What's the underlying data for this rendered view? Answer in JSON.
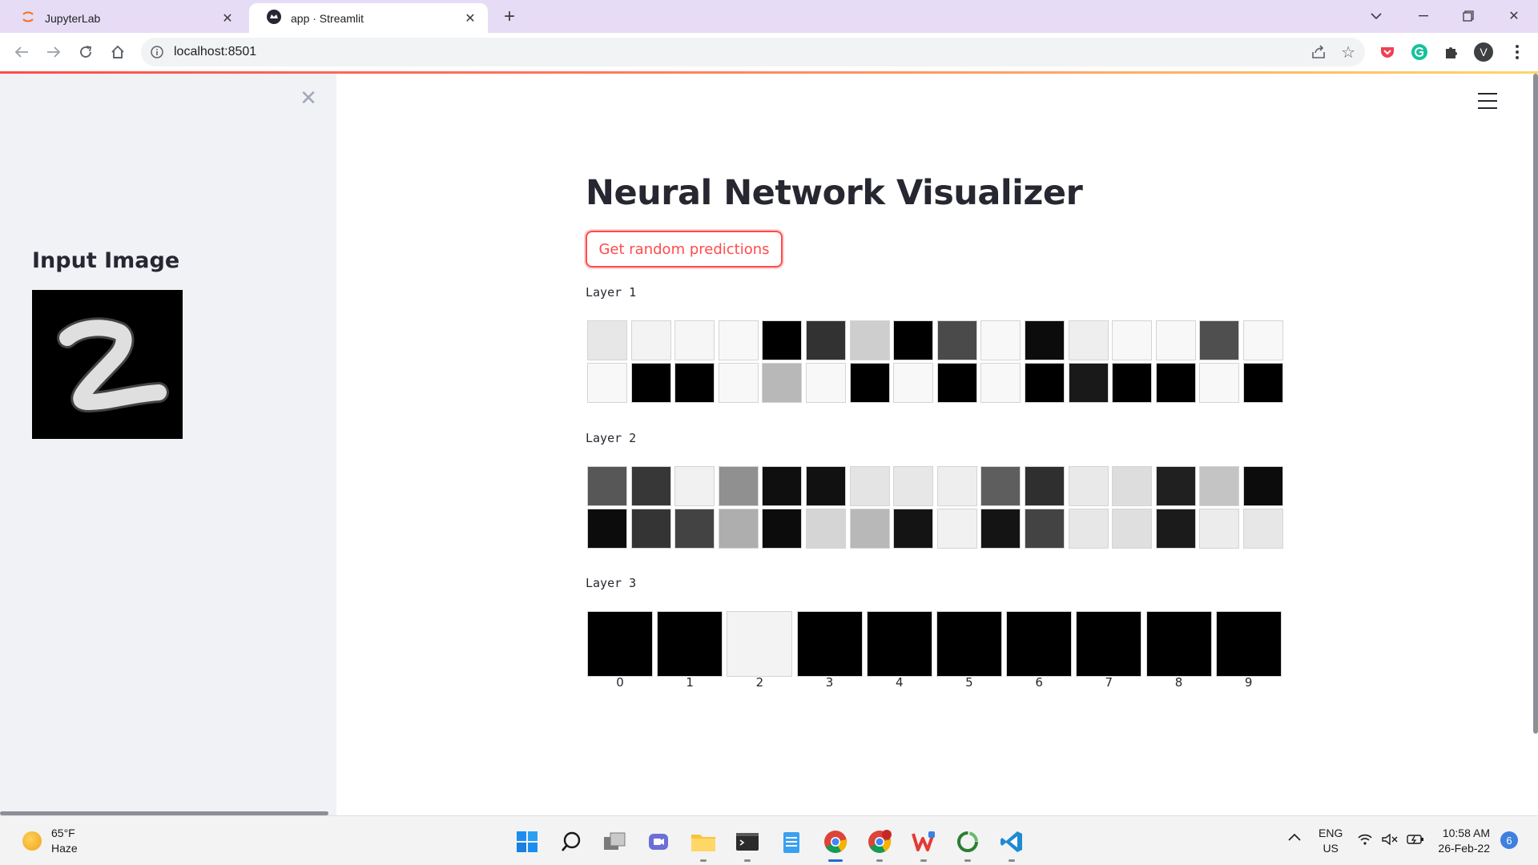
{
  "browser": {
    "tabs": [
      {
        "title": "JupyterLab",
        "active": false
      },
      {
        "title": "app · Streamlit",
        "active": true
      }
    ],
    "url": "localhost:8501",
    "profile_initial": "V"
  },
  "sidebar": {
    "heading": "Input Image",
    "input_digit_glyph": "2"
  },
  "main": {
    "title": "Neural Network Visualizer",
    "button_label": "Get random predictions",
    "layers": [
      {
        "label": "Layer 1",
        "activations": [
          0.93,
          0.98,
          0.99,
          1.0,
          0.0,
          0.2,
          0.83,
          0.0,
          0.3,
          1.0,
          0.05,
          0.96,
          1.0,
          1.0,
          0.32,
          1.0,
          1.0,
          0.0,
          0.0,
          1.0,
          0.74,
          1.0,
          0.0,
          1.0,
          0.0,
          1.0,
          0.0,
          0.1,
          0.0,
          0.0,
          1.0,
          0.0
        ]
      },
      {
        "label": "Layer 2",
        "activations": [
          0.35,
          0.22,
          0.97,
          0.58,
          0.06,
          0.07,
          0.92,
          0.93,
          0.96,
          0.38,
          0.19,
          0.94,
          0.89,
          0.13,
          0.79,
          0.05,
          0.05,
          0.21,
          0.27,
          0.7,
          0.05,
          0.86,
          0.74,
          0.08,
          0.97,
          0.08,
          0.27,
          0.93,
          0.9,
          0.11,
          0.95,
          0.93
        ]
      },
      {
        "label": "Layer 3",
        "output_labels": [
          "0",
          "1",
          "2",
          "3",
          "4",
          "5",
          "6",
          "7",
          "8",
          "9"
        ],
        "activations": [
          0.0,
          0.0,
          0.98,
          0.0,
          0.0,
          0.0,
          0.0,
          0.0,
          0.0,
          0.0
        ]
      }
    ]
  },
  "taskbar": {
    "weather_temp": "65°F",
    "weather_desc": "Haze",
    "language": "ENG",
    "region": "US",
    "time": "10:58 AM",
    "date": "26-Feb-22",
    "notification_count": "6"
  }
}
